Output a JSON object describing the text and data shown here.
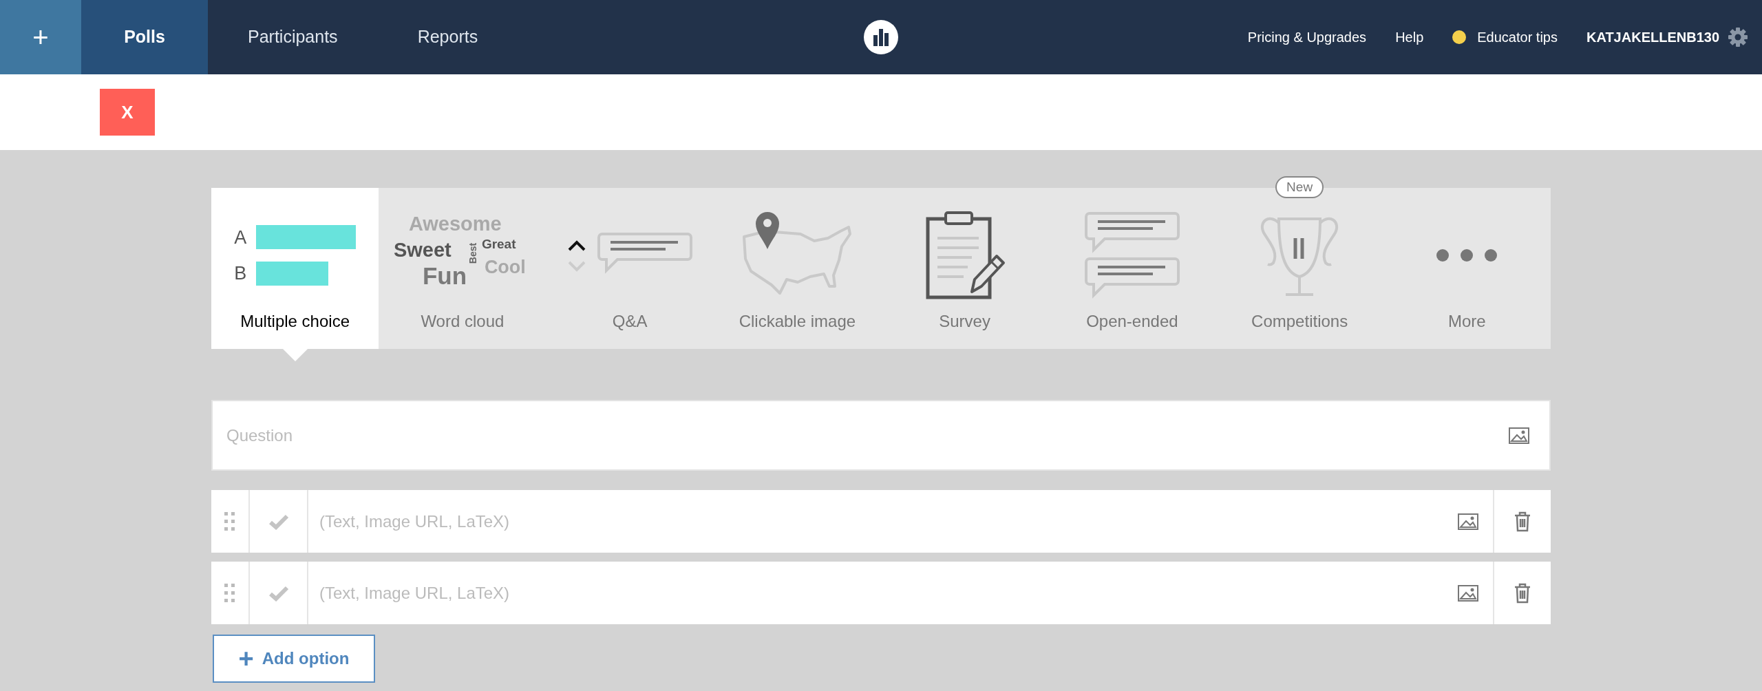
{
  "nav": {
    "add_button": "+",
    "tabs": [
      {
        "label": "Polls",
        "selected": true
      },
      {
        "label": "Participants",
        "selected": false
      },
      {
        "label": "Reports",
        "selected": false
      }
    ],
    "links": [
      {
        "kind": "link",
        "label": "Pricing & Upgrades"
      },
      {
        "kind": "link",
        "label": "Help"
      },
      {
        "kind": "tips",
        "label": "Educator tips",
        "color": "#f5d04c"
      },
      {
        "kind": "user",
        "label": "KATJAKELLENB130"
      }
    ]
  },
  "close_button": "X",
  "poll_types": [
    {
      "kind": "multiple_choice",
      "label": "Multiple choice",
      "selected": true,
      "letters": [
        "A",
        "B"
      ]
    },
    {
      "kind": "word_cloud",
      "label": "Word cloud",
      "selected": false,
      "words": [
        "Awesome",
        "Sweet",
        "Best",
        "Great",
        "Fun",
        "Cool"
      ]
    },
    {
      "kind": "qa",
      "label": "Q&A",
      "selected": false
    },
    {
      "kind": "clickable_image",
      "label": "Clickable image",
      "selected": false
    },
    {
      "kind": "survey",
      "label": "Survey",
      "selected": false
    },
    {
      "kind": "open_ended",
      "label": "Open-ended",
      "selected": false
    },
    {
      "kind": "competitions",
      "label": "Competitions",
      "selected": false,
      "badge": "New"
    },
    {
      "kind": "more",
      "label": "More",
      "selected": false
    }
  ],
  "question": {
    "placeholder": "Question"
  },
  "options": [
    {
      "placeholder": "(Text, Image URL, LaTeX)"
    },
    {
      "placeholder": "(Text, Image URL, LaTeX)"
    }
  ],
  "add_option": {
    "icon": "+",
    "label": "Add option"
  }
}
